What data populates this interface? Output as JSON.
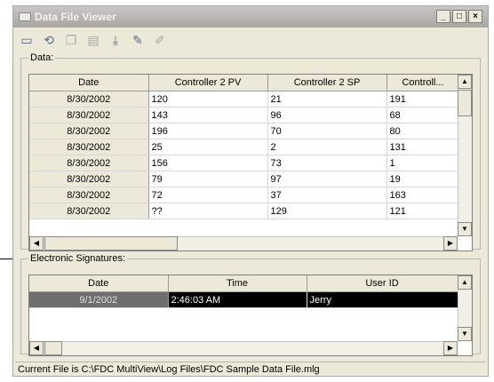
{
  "window": {
    "title": "Data File Viewer"
  },
  "toolbar": {
    "icons": [
      "open-folder-icon",
      "refresh-icon",
      "copy-icon",
      "paste-icon",
      "export-icon",
      "edit-icon",
      "sign-icon"
    ]
  },
  "data_group": {
    "label": "Data:",
    "columns": [
      "Date",
      "Controller 2  PV",
      "Controller 2  SP",
      "Controll..."
    ],
    "rows": [
      [
        "8/30/2002",
        "120",
        "21",
        "191"
      ],
      [
        "8/30/2002",
        "143",
        "96",
        "68"
      ],
      [
        "8/30/2002",
        "196",
        "70",
        "80"
      ],
      [
        "8/30/2002",
        "25",
        "2",
        "131"
      ],
      [
        "8/30/2002",
        "156",
        "73",
        "1"
      ],
      [
        "8/30/2002",
        "79",
        "97",
        "19"
      ],
      [
        "8/30/2002",
        "72",
        "37",
        "163"
      ],
      [
        "8/30/2002",
        "??",
        "129",
        "121"
      ]
    ]
  },
  "signatures_group": {
    "label": "Electronic Signatures:",
    "columns": [
      "Date",
      "Time",
      "User ID"
    ],
    "rows": [
      [
        "9/1/2002",
        "2:46:03 AM",
        "Jerry"
      ]
    ]
  },
  "status": {
    "text": "Current File is C:\\FDC MultiView\\Log Files\\FDC Sample Data File.mlg"
  }
}
